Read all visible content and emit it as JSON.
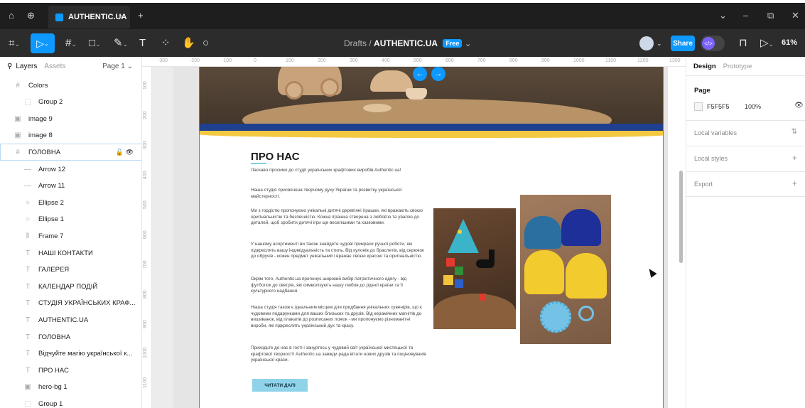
{
  "titlebar": {
    "tab_title": "AUTHENTIC.UA",
    "tab_close": "×",
    "new_tab": "+",
    "home_icon": "home-icon",
    "globe_icon": "globe-icon"
  },
  "toolbar": {
    "breadcrumb_parent": "Drafts",
    "breadcrumb_sep": "/",
    "file_name": "AUTHENTIC.UA",
    "plan_badge": "Free",
    "share_label": "Share",
    "zoom": "61%"
  },
  "left_panel": {
    "tab_layers": "Layers",
    "tab_assets": "Assets",
    "page_selector": "Page 1",
    "layers": [
      {
        "icon": "#",
        "label": "Colors",
        "indent": 0
      },
      {
        "icon": "⬚",
        "label": "Group 2",
        "indent": 1
      },
      {
        "icon": "▣",
        "label": "image 9",
        "indent": 0
      },
      {
        "icon": "▣",
        "label": "image 8",
        "indent": 0
      },
      {
        "icon": "#",
        "label": "ГОЛОВНА",
        "indent": 0,
        "selected": true
      },
      {
        "icon": "—",
        "label": "Arrow 12",
        "indent": 1
      },
      {
        "icon": "—",
        "label": "Arrow 11",
        "indent": 1
      },
      {
        "icon": "○",
        "label": "Ellipse 2",
        "indent": 1
      },
      {
        "icon": "○",
        "label": "Ellipse 1",
        "indent": 1
      },
      {
        "icon": "⦀",
        "label": "Frame 7",
        "indent": 1
      },
      {
        "icon": "T",
        "label": "НАШІ КОНТАКТИ",
        "indent": 1
      },
      {
        "icon": "T",
        "label": "ГАЛЕРЕЯ",
        "indent": 1
      },
      {
        "icon": "T",
        "label": "КАЛЕНДАР ПОДІЙ",
        "indent": 1
      },
      {
        "icon": "T",
        "label": "СТУДІЯ УКРАЇНСЬКИХ КРАФ...",
        "indent": 1
      },
      {
        "icon": "T",
        "label": "AUTHENTIC.UA",
        "indent": 1
      },
      {
        "icon": "T",
        "label": "ГОЛОВНА",
        "indent": 1
      },
      {
        "icon": "T",
        "label": "Відчуйте магію української к...",
        "indent": 1
      },
      {
        "icon": "T",
        "label": "ПРО НАС",
        "indent": 1
      },
      {
        "icon": "▣",
        "label": "hero-bg 1",
        "indent": 1
      },
      {
        "icon": "⬚",
        "label": "Group 1",
        "indent": 1
      }
    ]
  },
  "rulers": {
    "top": [
      "-300",
      "-200",
      "-100",
      "0",
      "100",
      "200",
      "300",
      "400",
      "500",
      "600",
      "700",
      "800",
      "900",
      "1000",
      "1100",
      "1200",
      "1300"
    ],
    "left": [
      "100",
      "200",
      "300",
      "400",
      "500",
      "600",
      "700",
      "800",
      "900",
      "1000",
      "1100"
    ]
  },
  "canvas": {
    "about_title": "ПРО НАС",
    "paragraphs": [
      "Ласкаво просимо до студії українських крафтових виробів Authentic.ua!",
      "Наша студія присвячена творчому духу України та розвитку української майстерності.",
      "Ми з гордістю пропонуємо унікальні дитячі дерев'яні іграшки, які вражають своєю оригінальністю та безпечністю. Кожна іграшка створена з любов'ю та увагою до деталей, щоб зробити дитячі ігри ще веселішими та казковими.",
      "У нашому асортименті ви також знайдете чудові прикраси ручної роботи, які підкреслять вашу індивідуальність та стиль. Від кулонів до браслетів, від сережок до обручів - кожен предмет унікальний і вражає своєю красою та оригінальністю.",
      "Окрім того, Authentic.ua пропонує широкий вибір патріотичного одягу - від футболок до светрів, які символізують нашу любов до рідної країни та її культурного надбання.",
      "Наша студія також є ідеальним місцем для придбання унікальних сувенірів, що є чудовими подарунками для ваших близьких та друзів. Від керамічних магнітів до вишиванок, від плакатів до розписаних ложок - ми пропонуємо різноманітні вироби, які підкреслять український дух та красу.",
      "Приходьте до нас в гості і зануртесь у чудовий світ української мистецької та крафтової творчості! Authentic.ua завжди рада вітати нових друзів та поціновувачів української краси."
    ],
    "read_more": "ЧИТАТИ ДАЛІ"
  },
  "right_panel": {
    "tab_design": "Design",
    "tab_prototype": "Prototype",
    "page_label": "Page",
    "page_color": "F5F5F5",
    "page_opacity": "100%",
    "local_variables": "Local variables",
    "local_styles": "Local styles",
    "export": "Export"
  },
  "colors": {
    "accent": "#0d99ff",
    "toolbar_bg": "#2c2c2c",
    "ukraine_blue": "#1f3f8f",
    "ukraine_yellow": "#f5c842",
    "button_cyan": "#8fd3ea"
  }
}
